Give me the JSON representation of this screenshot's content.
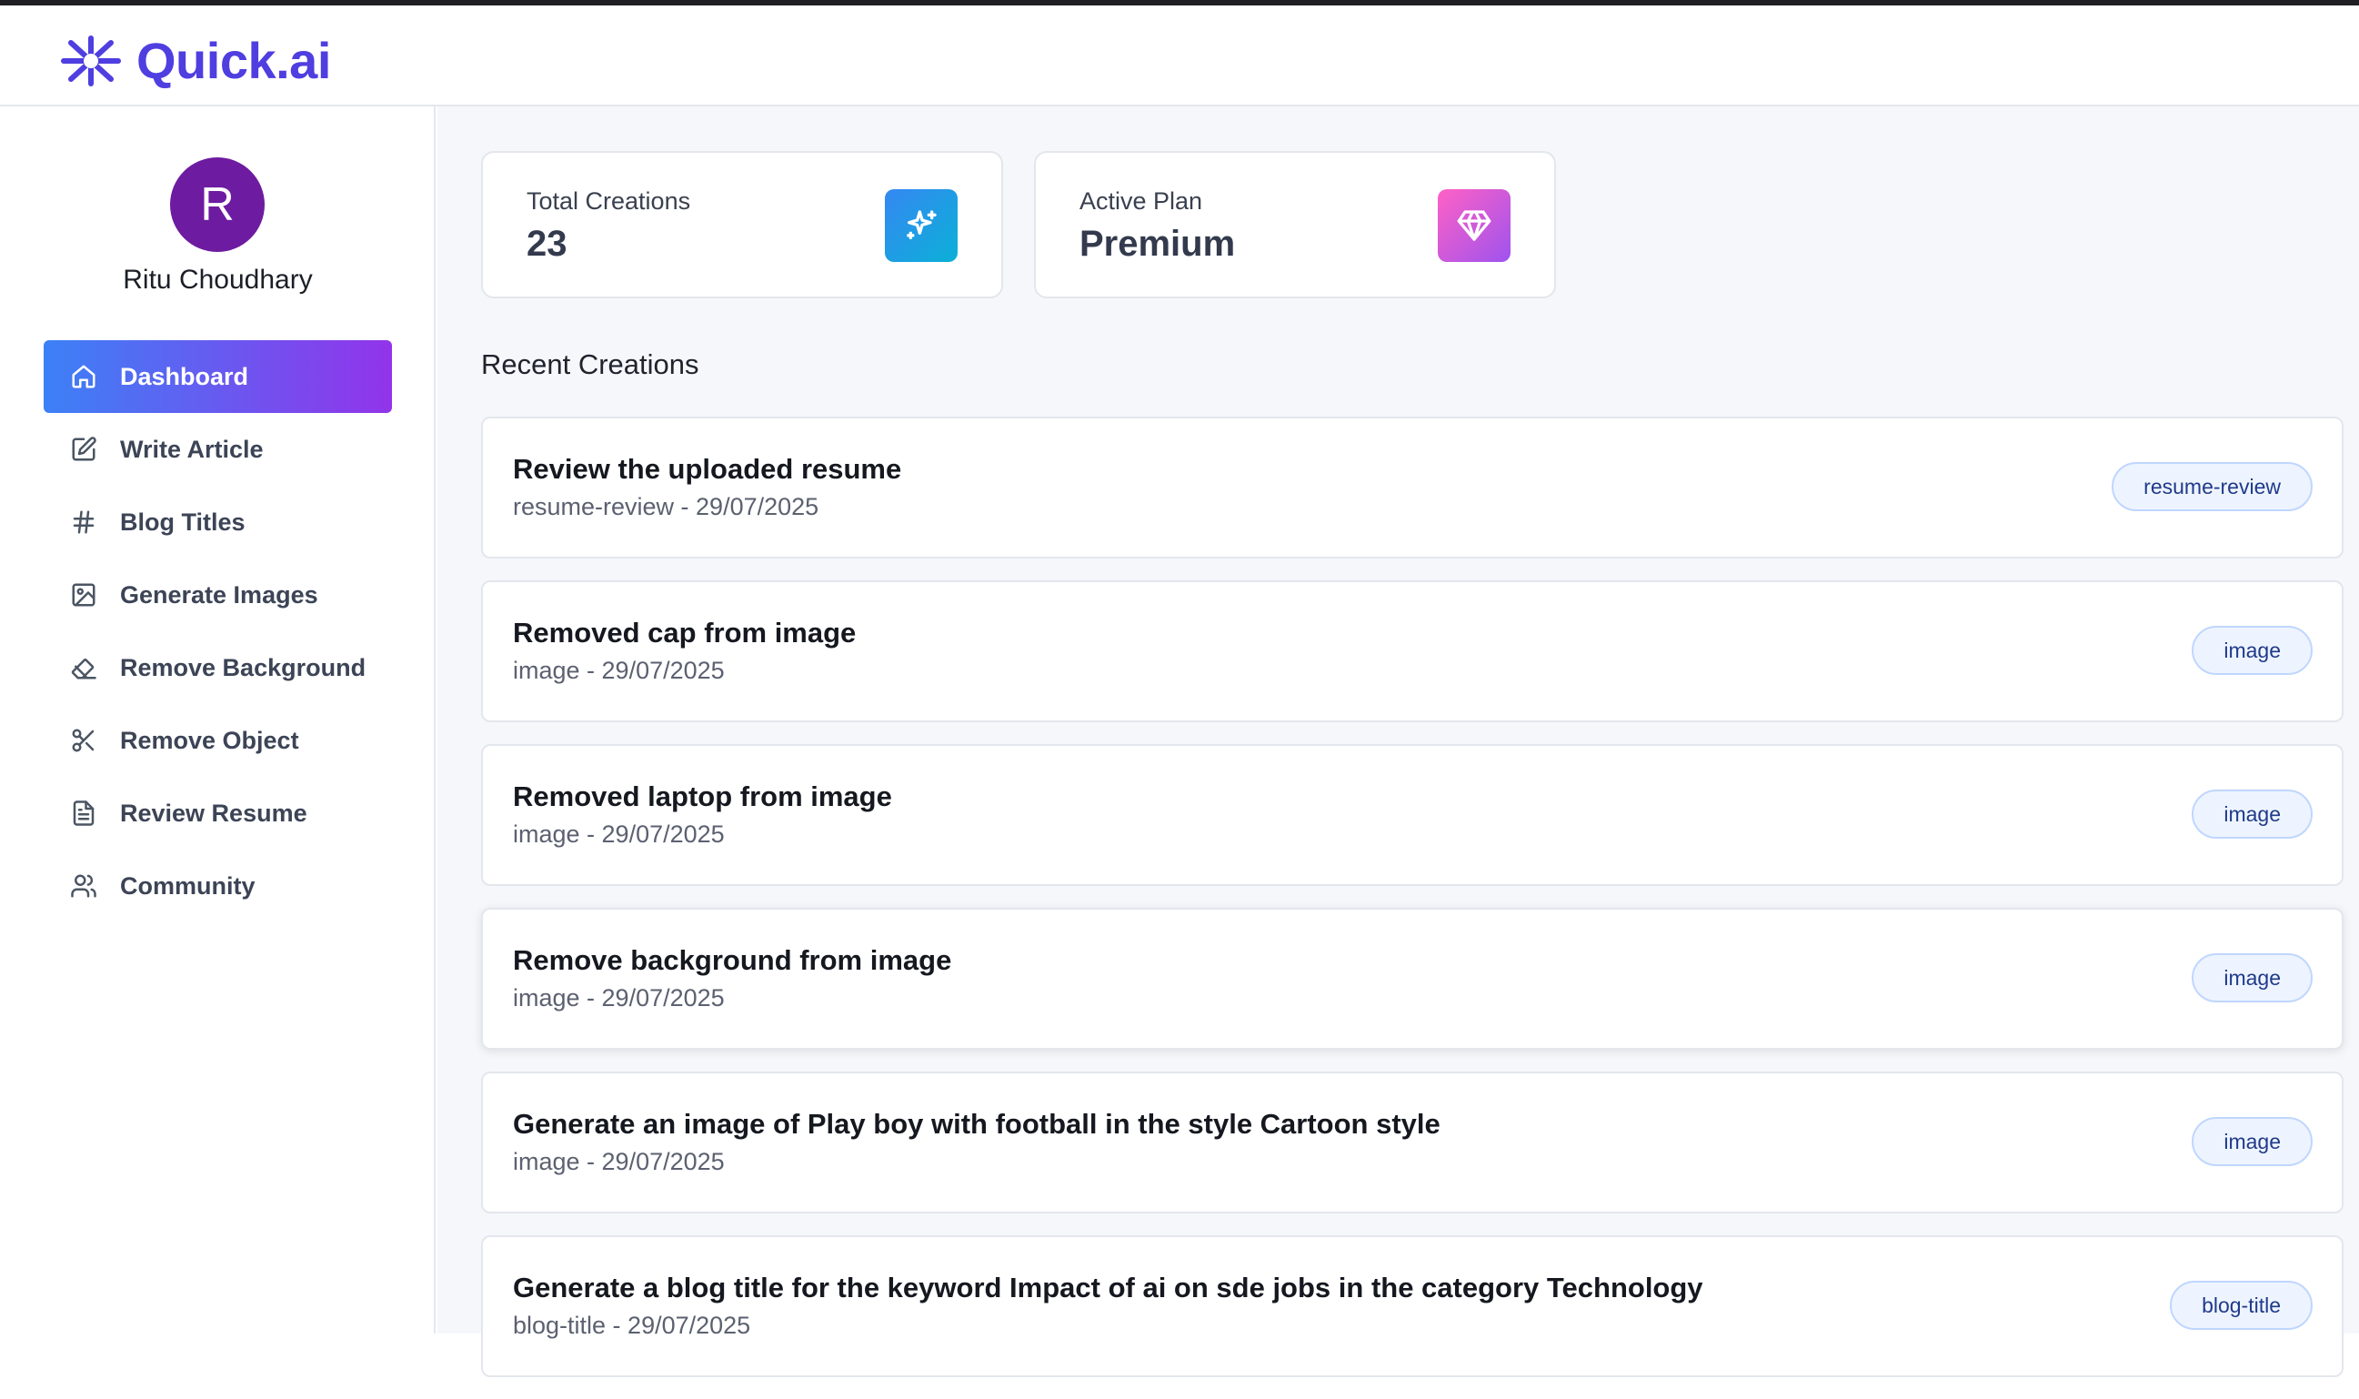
{
  "app": {
    "name": "Quick.ai"
  },
  "user": {
    "initial": "R",
    "name": "Ritu Choudhary"
  },
  "nav": [
    {
      "label": "Dashboard",
      "icon": "house-icon",
      "active": true
    },
    {
      "label": "Write Article",
      "icon": "square-pen-icon",
      "active": false
    },
    {
      "label": "Blog Titles",
      "icon": "hash-icon",
      "active": false
    },
    {
      "label": "Generate Images",
      "icon": "image-icon",
      "active": false
    },
    {
      "label": "Remove Background",
      "icon": "eraser-icon",
      "active": false
    },
    {
      "label": "Remove Object",
      "icon": "scissors-icon",
      "active": false
    },
    {
      "label": "Review Resume",
      "icon": "file-text-icon",
      "active": false
    },
    {
      "label": "Community",
      "icon": "users-icon",
      "active": false
    }
  ],
  "stats": {
    "total": {
      "label": "Total Creations",
      "value": "23",
      "icon": "sparkles-icon",
      "color_from": "#3588f2",
      "color_to": "#0bb0d7"
    },
    "plan": {
      "label": "Active Plan",
      "value": "Premium",
      "icon": "gem-icon",
      "color_from": "#ff61c5",
      "color_to": "#9e53ee"
    }
  },
  "recent": {
    "title": "Recent Creations",
    "items": [
      {
        "title": "Review the uploaded resume",
        "meta": "resume-review - 29/07/2025",
        "badge": "resume-review"
      },
      {
        "title": "Removed cap from image",
        "meta": "image - 29/07/2025",
        "badge": "image"
      },
      {
        "title": "Removed laptop from image",
        "meta": "image - 29/07/2025",
        "badge": "image"
      },
      {
        "title": "Remove background from image",
        "meta": "image - 29/07/2025",
        "badge": "image"
      },
      {
        "title": "Generate an image of Play boy with football in the style Cartoon style",
        "meta": "image - 29/07/2025",
        "badge": "image"
      },
      {
        "title": "Generate a blog title for the keyword Impact of ai on sde jobs in the category Technology",
        "meta": "blog-title - 29/07/2025",
        "badge": "blog-title"
      }
    ]
  },
  "colors": {
    "brand": "#4f3ee0",
    "avatar": "#6d1ba0",
    "nav_active_from": "#3c81f6",
    "nav_active_to": "#9234ea",
    "badge_bg": "#eef4ff",
    "badge_border": "#bfd6ff"
  }
}
